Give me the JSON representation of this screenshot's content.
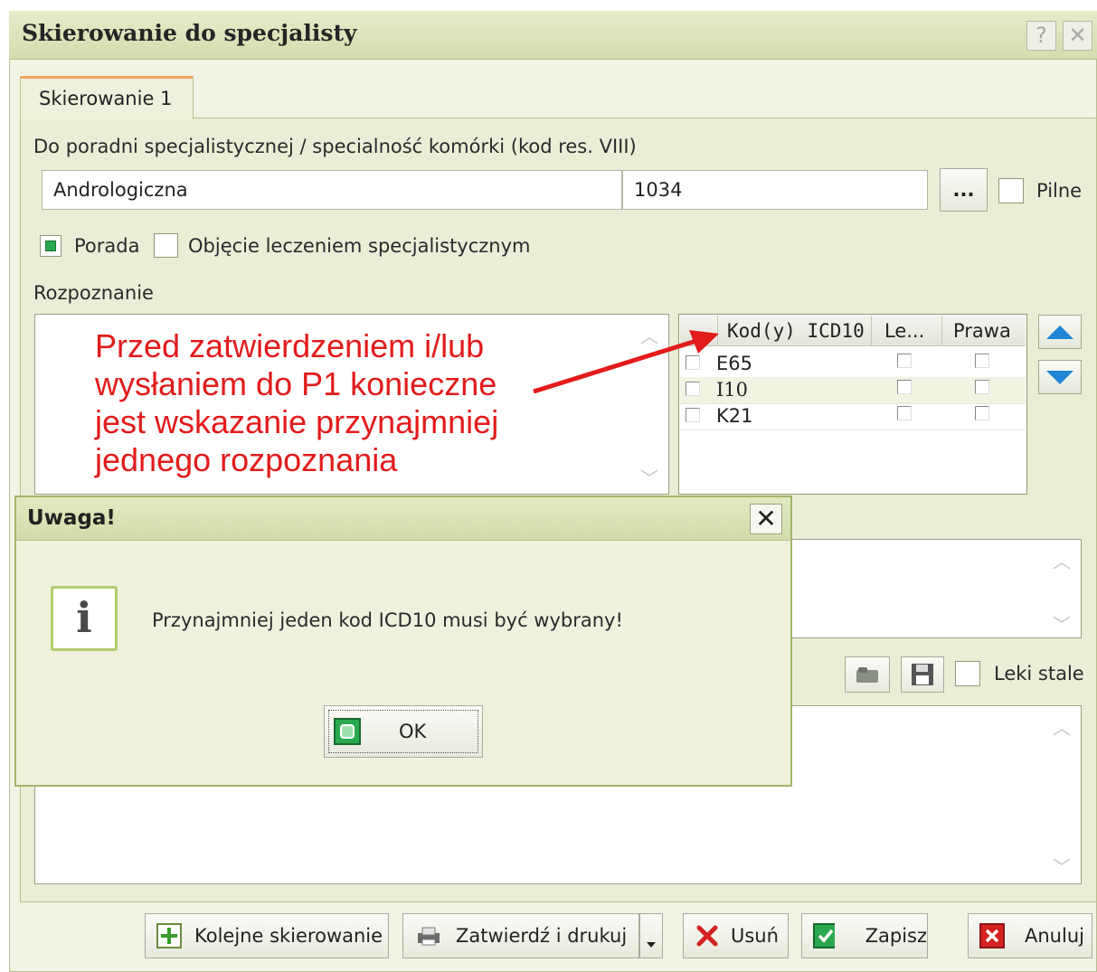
{
  "window": {
    "title": "Skierowanie do specjalisty",
    "help_label": "?",
    "close_label": "✕"
  },
  "tab": {
    "label": "Skierowanie 1"
  },
  "clinic": {
    "label": "Do poradni specjalistycznej / specialność komórki (kod res. VIII)",
    "name_value": "Andrologiczna",
    "code_value": "1034",
    "browse_label": "...",
    "urgent_label": "Pilne",
    "urgent_checked": false
  },
  "options": {
    "porada_label": "Porada",
    "porada_checked": true,
    "treatment_label": "Objęcie leczeniem specjalistycznym",
    "treatment_checked": false
  },
  "diagnosis": {
    "label": "Rozpoznanie",
    "grid_headers": [
      "Kod(y) ICD10",
      "Le...",
      "Prawa"
    ],
    "rows": [
      {
        "code": "E65",
        "selected": false,
        "le": false,
        "prawa": false
      },
      {
        "code": "I10",
        "selected": false,
        "le": false,
        "prawa": false
      },
      {
        "code": "K21",
        "selected": false,
        "le": false,
        "prawa": false
      }
    ]
  },
  "annotation": {
    "lines": [
      "Przed zatwierdzeniem i/lub",
      "wysłaniem do P1 konieczne",
      "jest wskazanie przynajmniej",
      "jednego rozpoznania"
    ],
    "color": "#e21b1b"
  },
  "meds": {
    "leki_stale_label": "Leki stale",
    "leki_stale_checked": false
  },
  "dialog": {
    "title": "Uwaga!",
    "close_label": "✕",
    "icon_glyph": "i",
    "message": "Przynajmniej jeden kod ICD10 musi być wybrany!",
    "ok_label": "OK"
  },
  "footer": {
    "next_label": "Kolejne skierowanie",
    "confirm_print_label": "Zatwierdź i drukuj",
    "delete_label": "Usuń",
    "save_label": "Zapisz",
    "cancel_label": "Anuluj"
  },
  "colors": {
    "accent_green": "#2aa84e",
    "delete_red": "#d42222",
    "arrow_blue": "#1f86d6"
  }
}
